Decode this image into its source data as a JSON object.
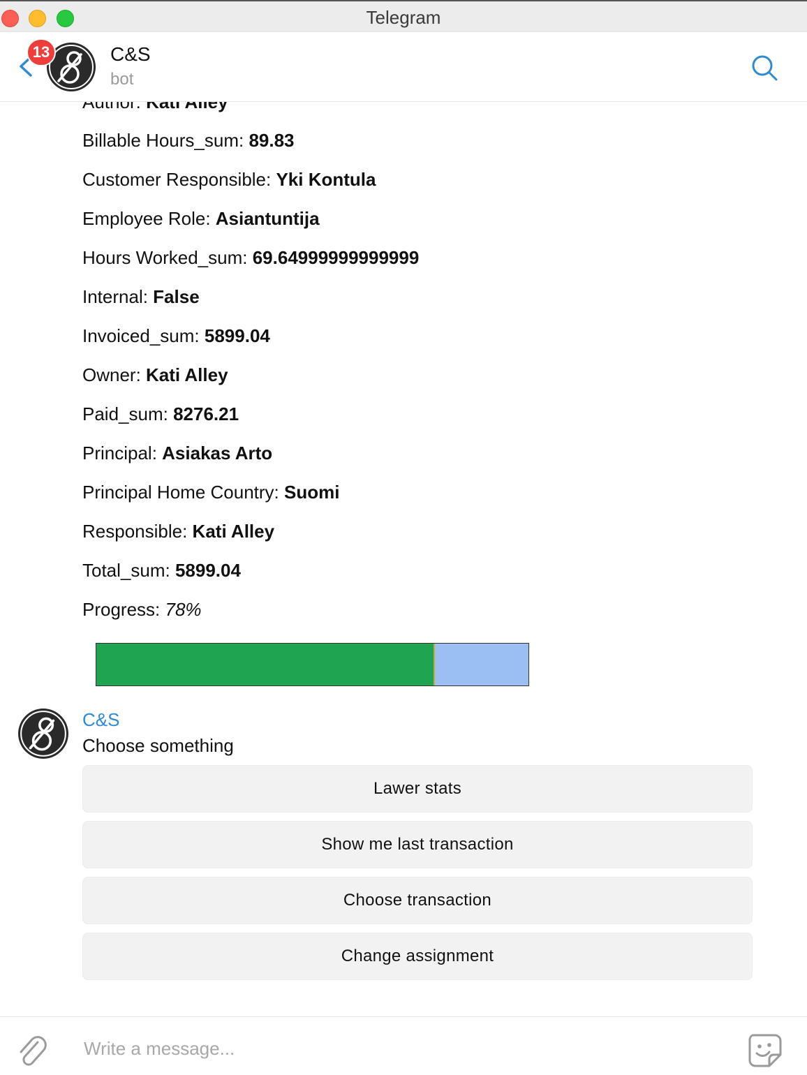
{
  "window": {
    "title": "Telegram"
  },
  "header": {
    "unread_count": "13",
    "chat_name": "C&S",
    "chat_subtitle": "bot"
  },
  "message": {
    "fields": [
      {
        "label": "Author: ",
        "value": "Kati Alley"
      },
      {
        "label": "Billable Hours_sum: ",
        "value": "89.83"
      },
      {
        "label": "Customer Responsible: ",
        "value": "Yki Kontula"
      },
      {
        "label": "Employee Role: ",
        "value": "Asiantuntija"
      },
      {
        "label": "Hours Worked_sum: ",
        "value": "69.64999999999999"
      },
      {
        "label": "Internal: ",
        "value": "False"
      },
      {
        "label": "Invoiced_sum: ",
        "value": "5899.04"
      },
      {
        "label": "Owner: ",
        "value": "Kati Alley"
      },
      {
        "label": "Paid_sum: ",
        "value": "8276.21"
      },
      {
        "label": "Principal: ",
        "value": "Asiakas Arto"
      },
      {
        "label": "Principal Home Country: ",
        "value": "Suomi"
      },
      {
        "label": "Responsible: ",
        "value": "Kati Alley"
      },
      {
        "label": "Total_sum: ",
        "value": "5899.04"
      }
    ],
    "progress_label": "Progress: ",
    "progress_value": "78%",
    "progress_fraction": 0.78,
    "progress_colors": {
      "fill": "#1fa552",
      "rest": "#9bbff0"
    }
  },
  "bot_message": {
    "sender": "C&S",
    "text": "Choose something",
    "buttons": [
      "Lawer stats",
      "Show me last transaction",
      "Choose transaction",
      "Change assignment"
    ]
  },
  "composer": {
    "placeholder": "Write a message..."
  },
  "icons": {
    "back": "chevron-left-icon",
    "search": "search-icon",
    "attach": "paperclip-icon",
    "sticker": "sticker-icon"
  },
  "colors": {
    "accent": "#2f8bd1",
    "badge": "#ef3e3a"
  }
}
